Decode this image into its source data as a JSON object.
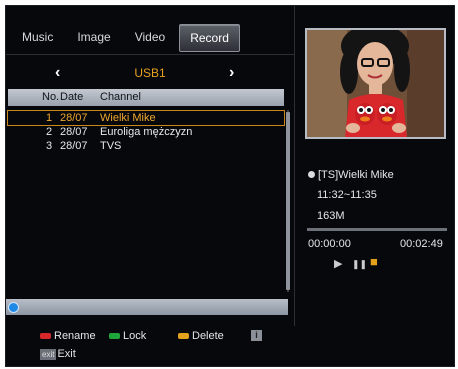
{
  "tabs": [
    {
      "label": "Music"
    },
    {
      "label": "Image"
    },
    {
      "label": "Video"
    },
    {
      "label": "Record",
      "active": true
    }
  ],
  "nav": {
    "left_arrow": "‹",
    "right_arrow": "›",
    "device": "USB1"
  },
  "table": {
    "headers": {
      "no": "No.",
      "date": "Date",
      "channel": "Channel"
    },
    "rows": [
      {
        "no": "1",
        "date": "28/07",
        "channel": "Wielki Mike",
        "selected": true
      },
      {
        "no": "2",
        "date": "28/07",
        "channel": "Euroliga mężczyzn"
      },
      {
        "no": "3",
        "date": "28/07",
        "channel": "TVS"
      }
    ]
  },
  "info": {
    "title": "[TS]Wielki Mike",
    "time_range": "11:32~11:35",
    "size": "163M",
    "position": "00:00:00",
    "duration": "00:02:49",
    "progress_fraction": 0.0
  },
  "controls": {
    "play": "▶",
    "pause": "❚❚",
    "stop": "■"
  },
  "footer": {
    "rename": "Rename",
    "lock": "Lock",
    "delete": "Delete",
    "info_key": "i",
    "exit_key": "exit",
    "exit": "Exit"
  },
  "colors": {
    "red_key": "#d8262b",
    "green_key": "#1fa63a",
    "yellow_key": "#e3a21a",
    "accent": "#e8a020",
    "background": "#07080c"
  }
}
